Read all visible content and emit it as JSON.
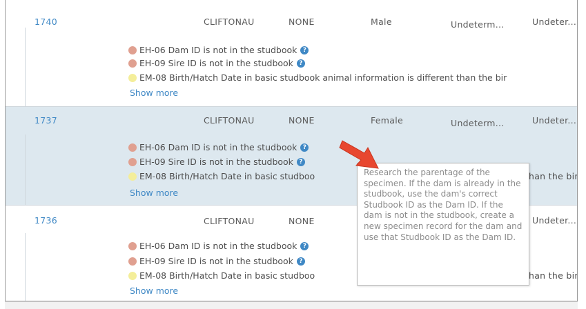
{
  "records": [
    {
      "id": "1740",
      "institution": "CLIFTONAU",
      "status": "NONE",
      "sex": "Male",
      "age": "Undeterm...",
      "col6": "Undeter...",
      "issues": [
        {
          "color": "red",
          "text": "EH-06 Dam ID is not in the studbook",
          "help": true
        },
        {
          "color": "red",
          "text": "EH-09 Sire ID is not in the studbook",
          "help": true
        },
        {
          "color": "yellow",
          "text": "EM-08 Birth/Hatch Date in basic studbook animal information is different than the bir",
          "help": false
        }
      ],
      "show_more": "Show more"
    },
    {
      "id": "1737",
      "institution": "CLIFTONAU",
      "status": "NONE",
      "sex": "Female",
      "age": "Undeterm...",
      "col6": "Undeter...",
      "issues": [
        {
          "color": "red",
          "text": "EH-06 Dam ID is not in the studbook",
          "help": true
        },
        {
          "color": "red",
          "text": "EH-09 Sire ID is not in the studbook",
          "help": true
        },
        {
          "color": "yellow",
          "text": "EM-08 Birth/Hatch Date in basic studboo",
          "help": false,
          "tail": "han the bir"
        }
      ],
      "show_more": "Show more"
    },
    {
      "id": "1736",
      "institution": "CLIFTONAU",
      "status": "NONE",
      "sex": "",
      "age": "",
      "col6": "Undeter...",
      "issues": [
        {
          "color": "red",
          "text": "EH-06 Dam ID is not in the studbook",
          "help": true
        },
        {
          "color": "red",
          "text": "EH-09 Sire ID is not in the studbook",
          "help": true
        },
        {
          "color": "yellow",
          "text": "EM-08 Birth/Hatch Date in basic studboo",
          "help": false,
          "tail": "han the bir"
        }
      ],
      "show_more": "Show more"
    }
  ],
  "tooltip": {
    "text": "Research the parentage of the specimen. If the dam is already in the studbook, use the dam's correct Studbook ID as the Dam ID. If the dam is not in the studbook, create a new specimen record for the dam and use that Studbook ID as the Dam ID."
  },
  "help_glyph": "?",
  "colors": {
    "link": "#3f88c5",
    "selected_row": "#dde8ef",
    "error_dot": "#e0a090",
    "warning_dot": "#f4ee9a",
    "arrow": "#e8472f"
  }
}
